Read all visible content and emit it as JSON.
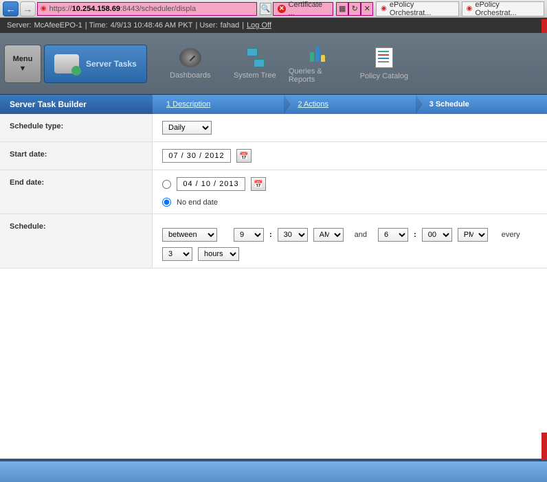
{
  "browser": {
    "url_prefix": "https://",
    "url_ip": "10.254.158.69",
    "url_suffix": ":8443/scheduler/displa",
    "cert_text": "Certificate ...",
    "tab1": "ePolicy Orchestrat...",
    "tab2": "ePolicy Orchestrat..."
  },
  "status": {
    "server": "McAfeeEPO-1",
    "time": "4/9/13 10:48:46 AM PKT",
    "user": "fahad",
    "logoff": "Log Off"
  },
  "toolbar": {
    "menu": "Menu",
    "server_tasks": "Server Tasks",
    "dashboards": "Dashboards",
    "system_tree": "System Tree",
    "queries": "Queries & Reports",
    "policy_catalog": "Policy Catalog"
  },
  "wizard": {
    "title": "Server Task Builder",
    "step1": "1 Description",
    "step2": "2 Actions",
    "step3": "3 Schedule"
  },
  "form": {
    "schedule_type_label": "Schedule type:",
    "schedule_type_value": "Daily",
    "start_date_label": "Start date:",
    "start_date_value": "07 / 30 / 2012",
    "end_date_label": "End date:",
    "end_date_value": "04 / 10 / 2013",
    "no_end_date": "No end date",
    "schedule_label": "Schedule:",
    "between": "between",
    "start_hour": "9",
    "start_min": "30",
    "start_ampm": "AM",
    "and": "and",
    "end_hour": "6",
    "end_min": "00",
    "end_ampm": "PM",
    "every": "every",
    "every_val": "3",
    "every_unit": "hours"
  }
}
